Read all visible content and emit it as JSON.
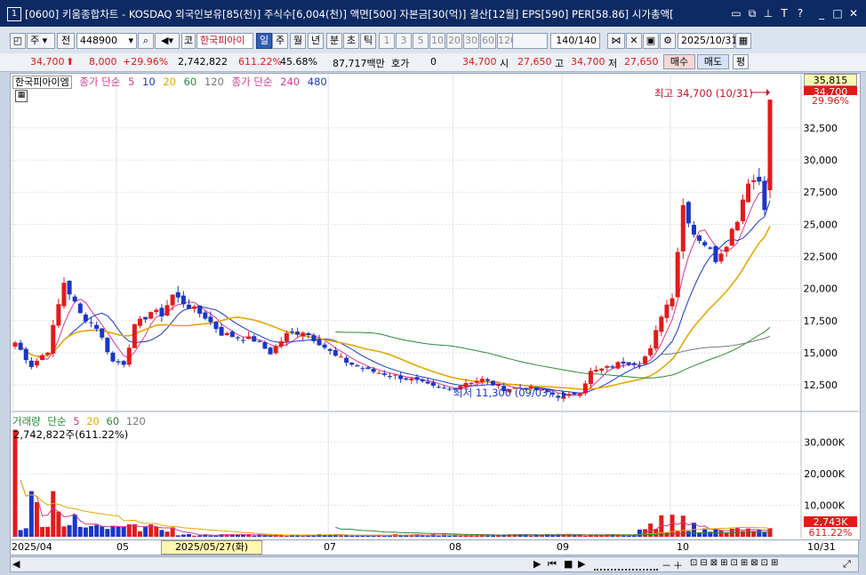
{
  "window": {
    "number": "1",
    "title": "[0600] 키움종합차트 - KOSDAQ 외국인보유[85(천)] 주식수[6,004(천)] 액면[500] 자본금[30(억)] 결산[12월] EPS[590] PER[58.86] 시가총액["
  },
  "toolbar": {
    "period_select": "주",
    "prev_label": "전",
    "code": "448900",
    "code_type": "코",
    "stock_name": "한국피아이",
    "tabs": [
      "일",
      "주",
      "월",
      "년",
      "분",
      "초",
      "틱"
    ],
    "active_tab": "일",
    "intervals": [
      "1",
      "3",
      "5",
      "10",
      "20",
      "30",
      "60",
      "120"
    ],
    "count": "140/140",
    "date": "2025/10/31"
  },
  "quote": {
    "price": "34,700",
    "change": "8,000",
    "change_pct": "+29.96%",
    "volume": "2,742,822",
    "volume_pct": "611.22%",
    "turnover_pct": "45.68%",
    "amount": "87,717백만",
    "hoga_label": "호가",
    "hoga_value": "0",
    "ask_price": "34,700",
    "open_label": "시",
    "open": "27,650",
    "high_label": "고",
    "high": "34,700",
    "low_label": "저",
    "low": "27,650",
    "buy_label": "매수",
    "sell_label": "매도",
    "eval_label": "평"
  },
  "legend": {
    "stock": "한국피아이엠",
    "ma_label": "종가 단순",
    "ma_periods": [
      "5",
      "10",
      "20",
      "60",
      "120"
    ],
    "ma_long_label": "종가 단순",
    "ma_long_periods": [
      "240",
      "480"
    ],
    "colors": {
      "5": "#e0348f",
      "10": "#1a36c8",
      "20": "#e8a800",
      "60": "#2a8a3a",
      "120": "#777777",
      "240": "#d23a8c",
      "480": "#1a36c8"
    }
  },
  "volume_legend": {
    "title": "거래량",
    "ma_label": "단순",
    "periods": [
      "5",
      "20",
      "60",
      "120"
    ],
    "current": "2,742,822주(611.22%)"
  },
  "annotations": {
    "high_label": "최고 34,700 (10/31)",
    "low_label": "최저 11,300 (09/03)"
  },
  "price_axis": {
    "current_box": "35,815",
    "last_price": "34,700",
    "last_pct": "29.96%",
    "ticks": [
      "32,500",
      "30,000",
      "27,500",
      "25,000",
      "22,500",
      "20,000",
      "17,500",
      "15,000",
      "12,500"
    ]
  },
  "volume_axis": {
    "ticks": [
      "30,000K",
      "20,000K",
      "10,000K"
    ],
    "last_value": "2,743K",
    "last_pct": "611.22%"
  },
  "x_axis": {
    "labels": [
      "2025/04",
      "05",
      "07",
      "08",
      "09",
      "10"
    ],
    "cursor_label": "2025/05/27(화)",
    "right_label": "10/31"
  },
  "chart_data": {
    "type": "candlestick",
    "title": "",
    "ylim": [
      10500,
      35815
    ],
    "volume_ylim": [
      0,
      35000
    ],
    "months": [
      {
        "label": "2025/04",
        "index": 0
      },
      {
        "label": "05",
        "index": 19
      },
      {
        "label": "07",
        "index": 58
      },
      {
        "label": "08",
        "index": 81
      },
      {
        "label": "09",
        "index": 101
      },
      {
        "label": "10",
        "index": 121
      }
    ],
    "anchors": [
      {
        "i": 0,
        "c": 15800
      },
      {
        "i": 3,
        "c": 14000
      },
      {
        "i": 6,
        "c": 15200
      },
      {
        "i": 9,
        "c": 20500
      },
      {
        "i": 12,
        "c": 18000
      },
      {
        "i": 15,
        "c": 17000
      },
      {
        "i": 18,
        "c": 14300
      },
      {
        "i": 20,
        "c": 14200
      },
      {
        "i": 22,
        "c": 17000
      },
      {
        "i": 25,
        "c": 18200
      },
      {
        "i": 27,
        "c": 18000
      },
      {
        "i": 29,
        "c": 19500
      },
      {
        "i": 32,
        "c": 18600
      },
      {
        "i": 35,
        "c": 17800
      },
      {
        "i": 38,
        "c": 16500
      },
      {
        "i": 41,
        "c": 16200
      },
      {
        "i": 44,
        "c": 16000
      },
      {
        "i": 47,
        "c": 15000
      },
      {
        "i": 50,
        "c": 16400
      },
      {
        "i": 53,
        "c": 16700
      },
      {
        "i": 56,
        "c": 15800
      },
      {
        "i": 59,
        "c": 14700
      },
      {
        "i": 62,
        "c": 14100
      },
      {
        "i": 65,
        "c": 13600
      },
      {
        "i": 69,
        "c": 13300
      },
      {
        "i": 73,
        "c": 12900
      },
      {
        "i": 77,
        "c": 12300
      },
      {
        "i": 80,
        "c": 12100
      },
      {
        "i": 83,
        "c": 12700
      },
      {
        "i": 86,
        "c": 12900
      },
      {
        "i": 90,
        "c": 12200
      },
      {
        "i": 94,
        "c": 12300
      },
      {
        "i": 98,
        "c": 11900
      },
      {
        "i": 101,
        "c": 11500
      },
      {
        "i": 104,
        "c": 12000
      },
      {
        "i": 106,
        "c": 13500
      },
      {
        "i": 109,
        "c": 13800
      },
      {
        "i": 112,
        "c": 14300
      },
      {
        "i": 115,
        "c": 14200
      },
      {
        "i": 117,
        "c": 15200
      },
      {
        "i": 119,
        "c": 18000
      },
      {
        "i": 121,
        "c": 19500
      },
      {
        "i": 123,
        "c": 26500
      },
      {
        "i": 125,
        "c": 24300
      },
      {
        "i": 127,
        "c": 23500
      },
      {
        "i": 129,
        "c": 22300
      },
      {
        "i": 131,
        "c": 23600
      },
      {
        "i": 133,
        "c": 25500
      },
      {
        "i": 135,
        "c": 28500
      },
      {
        "i": 137,
        "c": 28400
      },
      {
        "i": 138,
        "c": 26500
      },
      {
        "i": 139,
        "c": 34700
      }
    ],
    "volume_spikes": [
      {
        "i": 0,
        "v": 34000
      },
      {
        "i": 3,
        "v": 14500
      },
      {
        "i": 4,
        "v": 11000
      },
      {
        "i": 7,
        "v": 14500
      },
      {
        "i": 8,
        "v": 8000
      },
      {
        "i": 11,
        "v": 7000
      },
      {
        "i": 18,
        "v": 3500
      },
      {
        "i": 22,
        "v": 4000
      },
      {
        "i": 26,
        "v": 3200
      },
      {
        "i": 29,
        "v": 3000
      },
      {
        "i": 117,
        "v": 4200
      },
      {
        "i": 119,
        "v": 6800
      },
      {
        "i": 121,
        "v": 7000
      },
      {
        "i": 123,
        "v": 6700
      },
      {
        "i": 125,
        "v": 4500
      },
      {
        "i": 133,
        "v": 2800
      },
      {
        "i": 139,
        "v": 2743
      }
    ]
  }
}
